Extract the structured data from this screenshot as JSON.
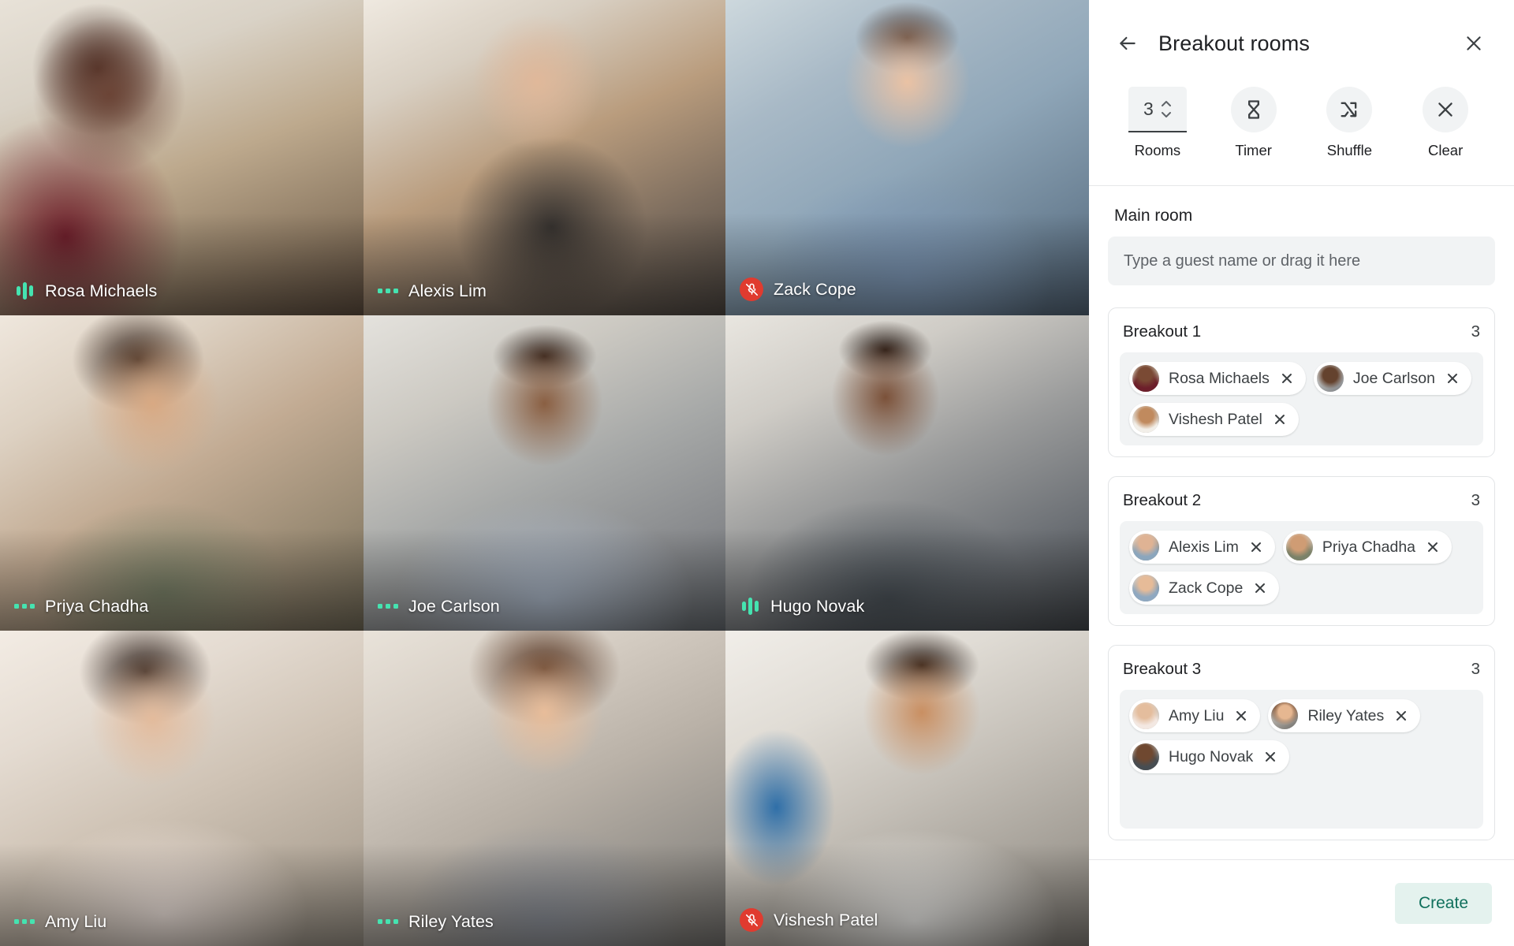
{
  "panel": {
    "title": "Breakout rooms",
    "back_icon": "arrow-left-icon",
    "close_icon": "close-icon",
    "toolbar": {
      "rooms": {
        "value": "3",
        "label": "Rooms",
        "icon": "stepper-arrows-icon"
      },
      "timer": {
        "label": "Timer",
        "icon": "hourglass-icon"
      },
      "shuffle": {
        "label": "Shuffle",
        "icon": "shuffle-icon"
      },
      "clear": {
        "label": "Clear",
        "icon": "close-icon"
      }
    },
    "main_room": {
      "title": "Main room",
      "placeholder": "Type a guest name or drag it here",
      "value": ""
    },
    "rooms": [
      {
        "title": "Breakout 1",
        "count": "3",
        "members": [
          {
            "name": "Rosa Michaels",
            "remove_icon": "close-icon"
          },
          {
            "name": "Joe Carlson",
            "remove_icon": "close-icon"
          },
          {
            "name": "Vishesh Patel",
            "remove_icon": "close-icon"
          }
        ]
      },
      {
        "title": "Breakout 2",
        "count": "3",
        "members": [
          {
            "name": "Alexis Lim",
            "remove_icon": "close-icon"
          },
          {
            "name": "Priya Chadha",
            "remove_icon": "close-icon"
          },
          {
            "name": "Zack Cope",
            "remove_icon": "close-icon"
          }
        ]
      },
      {
        "title": "Breakout 3",
        "count": "3",
        "members": [
          {
            "name": "Amy Liu",
            "remove_icon": "close-icon"
          },
          {
            "name": "Riley Yates",
            "remove_icon": "close-icon"
          },
          {
            "name": "Hugo Novak",
            "remove_icon": "close-icon"
          }
        ]
      }
    ],
    "footer": {
      "create_label": "Create"
    }
  },
  "grid": {
    "tiles": [
      {
        "name": "Rosa Michaels",
        "mic": "speaking",
        "mic_icon": "audio-wave-icon"
      },
      {
        "name": "Alexis Lim",
        "mic": "idle",
        "mic_icon": "mic-dots-icon"
      },
      {
        "name": "Zack Cope",
        "mic": "muted",
        "mic_icon": "mic-off-icon"
      },
      {
        "name": "Priya Chadha",
        "mic": "idle",
        "mic_icon": "mic-dots-icon"
      },
      {
        "name": "Joe Carlson",
        "mic": "idle",
        "mic_icon": "mic-dots-icon"
      },
      {
        "name": "Hugo Novak",
        "mic": "speaking",
        "mic_icon": "audio-wave-icon"
      },
      {
        "name": "Amy Liu",
        "mic": "idle",
        "mic_icon": "mic-dots-icon"
      },
      {
        "name": "Riley Yates",
        "mic": "idle",
        "mic_icon": "mic-dots-icon"
      },
      {
        "name": "Vishesh Patel",
        "mic": "muted",
        "mic_icon": "mic-off-icon"
      }
    ]
  },
  "colors": {
    "mic_active": "#45e3b0",
    "mic_muted": "#e03b2f",
    "create_bg": "#e4f2ee",
    "create_text": "#10705c",
    "panel_bg": "#ffffff",
    "dropzone_bg": "#f1f3f4"
  }
}
